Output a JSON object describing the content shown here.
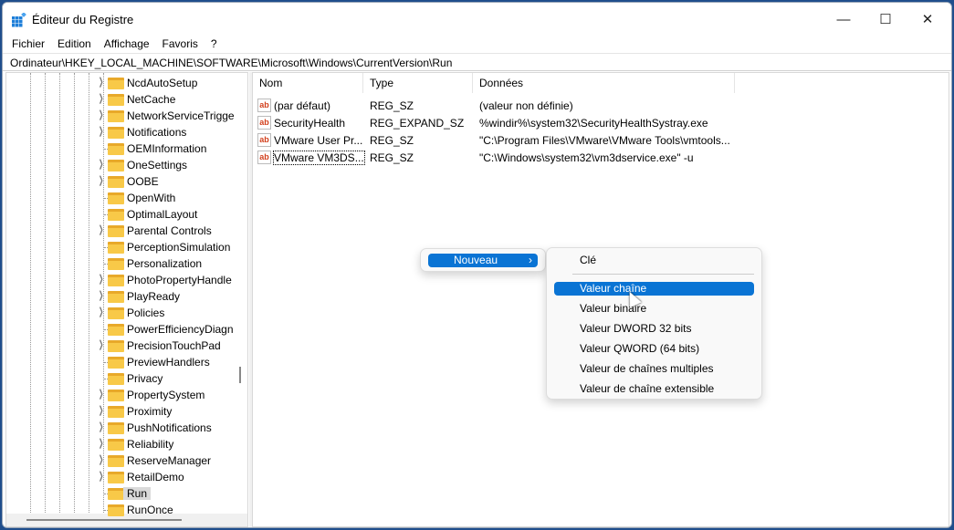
{
  "window": {
    "title": "Éditeur du Registre",
    "minimize": "—",
    "maximize": "☐",
    "close": "✕"
  },
  "menu": [
    "Fichier",
    "Edition",
    "Affichage",
    "Favoris",
    "?"
  ],
  "address": "Ordinateur\\HKEY_LOCAL_MACHINE\\SOFTWARE\\Microsoft\\Windows\\CurrentVersion\\Run",
  "tree": [
    {
      "label": "NcdAutoSetup",
      "exp": true
    },
    {
      "label": "NetCache",
      "exp": true
    },
    {
      "label": "NetworkServiceTrigge",
      "exp": true
    },
    {
      "label": "Notifications",
      "exp": true
    },
    {
      "label": "OEMInformation",
      "exp": false
    },
    {
      "label": "OneSettings",
      "exp": true
    },
    {
      "label": "OOBE",
      "exp": true
    },
    {
      "label": "OpenWith",
      "exp": false
    },
    {
      "label": "OptimalLayout",
      "exp": false
    },
    {
      "label": "Parental Controls",
      "exp": true
    },
    {
      "label": "PerceptionSimulation",
      "exp": false
    },
    {
      "label": "Personalization",
      "exp": false
    },
    {
      "label": "PhotoPropertyHandle",
      "exp": true
    },
    {
      "label": "PlayReady",
      "exp": true
    },
    {
      "label": "Policies",
      "exp": true
    },
    {
      "label": "PowerEfficiencyDiagn",
      "exp": false
    },
    {
      "label": "PrecisionTouchPad",
      "exp": true
    },
    {
      "label": "PreviewHandlers",
      "exp": false
    },
    {
      "label": "Privacy",
      "exp": false
    },
    {
      "label": "PropertySystem",
      "exp": true
    },
    {
      "label": "Proximity",
      "exp": true
    },
    {
      "label": "PushNotifications",
      "exp": true
    },
    {
      "label": "Reliability",
      "exp": true
    },
    {
      "label": "ReserveManager",
      "exp": true
    },
    {
      "label": "RetailDemo",
      "exp": true
    },
    {
      "label": "Run",
      "exp": false,
      "selected": true
    },
    {
      "label": "RunOnce",
      "exp": false
    }
  ],
  "columns": [
    "Nom",
    "Type",
    "Données"
  ],
  "values": [
    {
      "name": "(par défaut)",
      "type": "REG_SZ",
      "data": "(valeur non définie)"
    },
    {
      "name": "SecurityHealth",
      "type": "REG_EXPAND_SZ",
      "data": "%windir%\\system32\\SecurityHealthSystray.exe"
    },
    {
      "name": "VMware User Pr...",
      "type": "REG_SZ",
      "data": "\"C:\\Program Files\\VMware\\VMware Tools\\vmtools..."
    },
    {
      "name": "VMware VM3DS...",
      "type": "REG_SZ",
      "data": "\"C:\\Windows\\system32\\vm3dservice.exe\" -u"
    }
  ],
  "value_icon": "ab",
  "context_menu": {
    "item": "Nouveau",
    "arrow": "›"
  },
  "submenu": {
    "items": [
      "Clé",
      "Valeur chaîne",
      "Valeur binaire",
      "Valeur DWORD 32 bits",
      "Valeur QWORD (64 bits)",
      "Valeur de chaînes multiples",
      "Valeur de chaîne extensible"
    ],
    "highlighted": "Valeur chaîne"
  },
  "colors": {
    "accent": "#0a74d4",
    "folder": "#f8c948"
  }
}
